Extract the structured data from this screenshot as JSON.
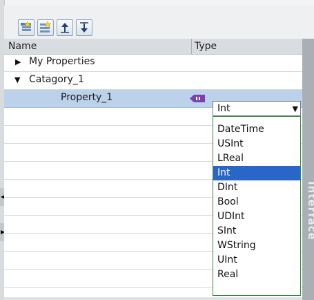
{
  "toolbar": {
    "buttons": [
      {
        "icon": "add-category-icon"
      },
      {
        "icon": "add-property-icon"
      },
      {
        "icon": "move-up-icon"
      },
      {
        "icon": "move-down-icon"
      }
    ]
  },
  "table": {
    "columns": {
      "name": "Name",
      "type": "Type"
    },
    "rows": [
      {
        "label": "My Properties",
        "expanded": false
      },
      {
        "label": "Catagory_1",
        "expanded": true
      },
      {
        "label": "Property_1",
        "type": "Int"
      }
    ]
  },
  "type_dropdown": {
    "selected": "Int",
    "options": [
      "DateTime",
      "USInt",
      "LReal",
      "Int",
      "DInt",
      "Bool",
      "UDInt",
      "SInt",
      "WString",
      "UInt",
      "Real"
    ],
    "highlighted_index": 3
  },
  "side_panel": {
    "label": "Interface"
  },
  "colors": {
    "selection": "#bcd1ea",
    "highlight": "#2a66c8",
    "dropdown_border": "#2e8b3a"
  }
}
